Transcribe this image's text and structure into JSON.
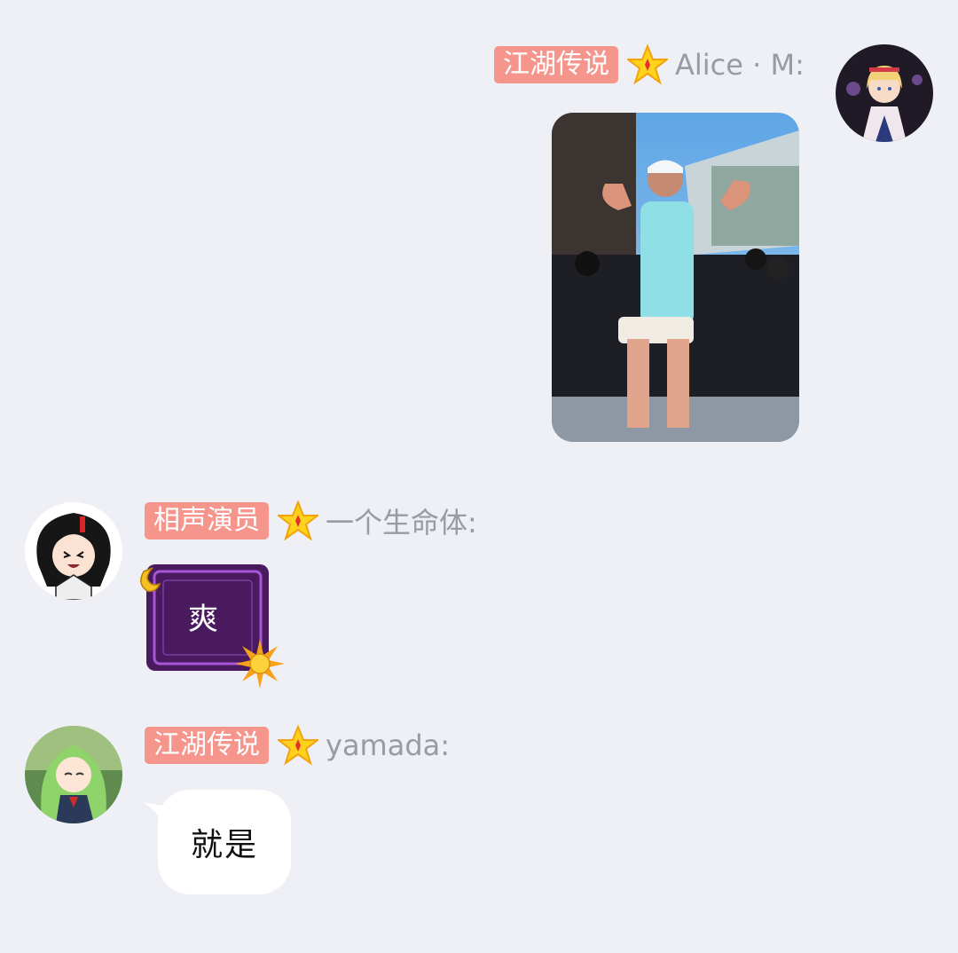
{
  "messages": [
    {
      "side": "right",
      "title_badge": "江湖传说",
      "sender": "Alice · M:",
      "content_type": "image",
      "avatar_icon": "alice-avatar"
    },
    {
      "side": "left",
      "title_badge": "相声演员",
      "sender": "一个生命体:",
      "content_type": "sticker",
      "sticker_text": "爽",
      "avatar_icon": "black-hair-anime-avatar"
    },
    {
      "side": "left",
      "title_badge": "江湖传说",
      "sender": "yamada:",
      "content_type": "text",
      "text": "就是",
      "avatar_icon": "green-hair-anime-avatar"
    }
  ],
  "colors": {
    "background": "#eff0f6",
    "badge": "#f6958c",
    "name": "#9a9aa2",
    "sticker": "#4a1a5e"
  }
}
